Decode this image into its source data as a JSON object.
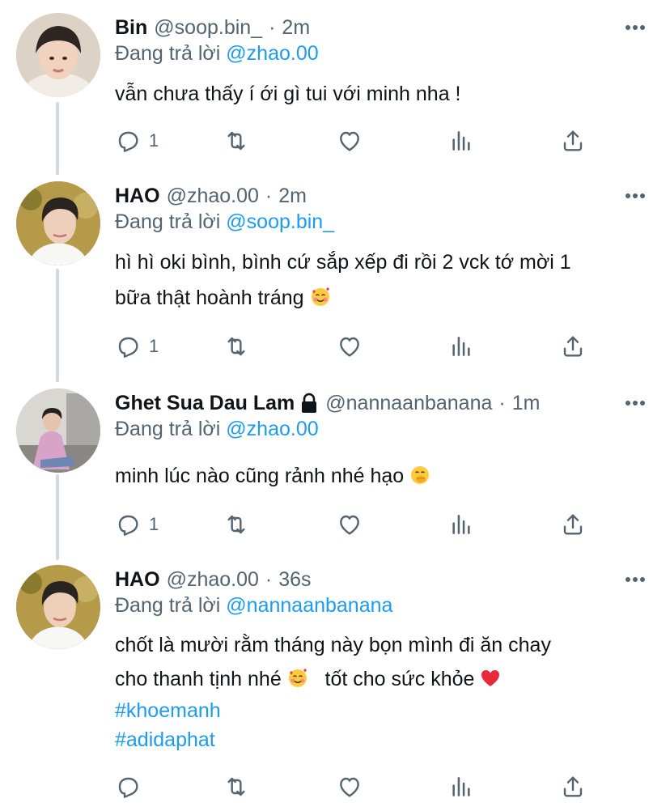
{
  "colors": {
    "accent": "#1d9bf0",
    "muted": "#536471",
    "text": "#0f1419",
    "thread_line": "#cfd9de"
  },
  "tweets": [
    {
      "name": "Bin",
      "handle": "@soop.bin_",
      "dot": "·",
      "time": "2m",
      "replying_prefix": "Đang trả lời",
      "replying_to": "@zhao.00",
      "text_lines": [
        "vẫn chưa thấy í ới gì tui với minh nha !"
      ],
      "reply_count": "1",
      "icons": [
        "more-icon",
        "reply-icon",
        "retweet-icon",
        "like-icon",
        "analytics-icon",
        "share-icon"
      ]
    },
    {
      "name": "HAO",
      "handle": "@zhao.00",
      "dot": "·",
      "time": "2m",
      "replying_prefix": "Đang trả lời",
      "replying_to": "@soop.bin_",
      "text_lines": [
        "hì hì oki bình, bình cứ sắp xếp đi rồi 2 vck tớ mời 1",
        "bữa thật hoành tráng"
      ],
      "emoji": "smiling-face-with-hearts",
      "reply_count": "1"
    },
    {
      "name": "Ghet Sua Dau Lam",
      "handle": "@nannaanbanana",
      "dot": "·",
      "time": "1m",
      "replying_prefix": "Đang trả lời",
      "replying_to": "@zhao.00",
      "text_lines": [
        "minh lúc nào cũng rảnh nhé hạo"
      ],
      "emoji": "face-with-hand-over-mouth",
      "reply_count": "1",
      "protected_icon": "lock-icon"
    },
    {
      "name": "HAO",
      "handle": "@zhao.00",
      "dot": "·",
      "time": "36s",
      "replying_prefix": "Đang trả lời",
      "replying_to": "@nannaanbanana",
      "text_line_1": "chốt là mười rằm tháng này bọn mình đi ăn chay",
      "text_line_2a": "cho thanh tịnh nhé",
      "text_line_2b": "tốt cho sức khỏe",
      "emojis": [
        "smiling-face-with-hearts",
        "red-heart"
      ],
      "hashtags": [
        "#khoemanh",
        "#adidaphat"
      ],
      "reply_count": ""
    }
  ]
}
